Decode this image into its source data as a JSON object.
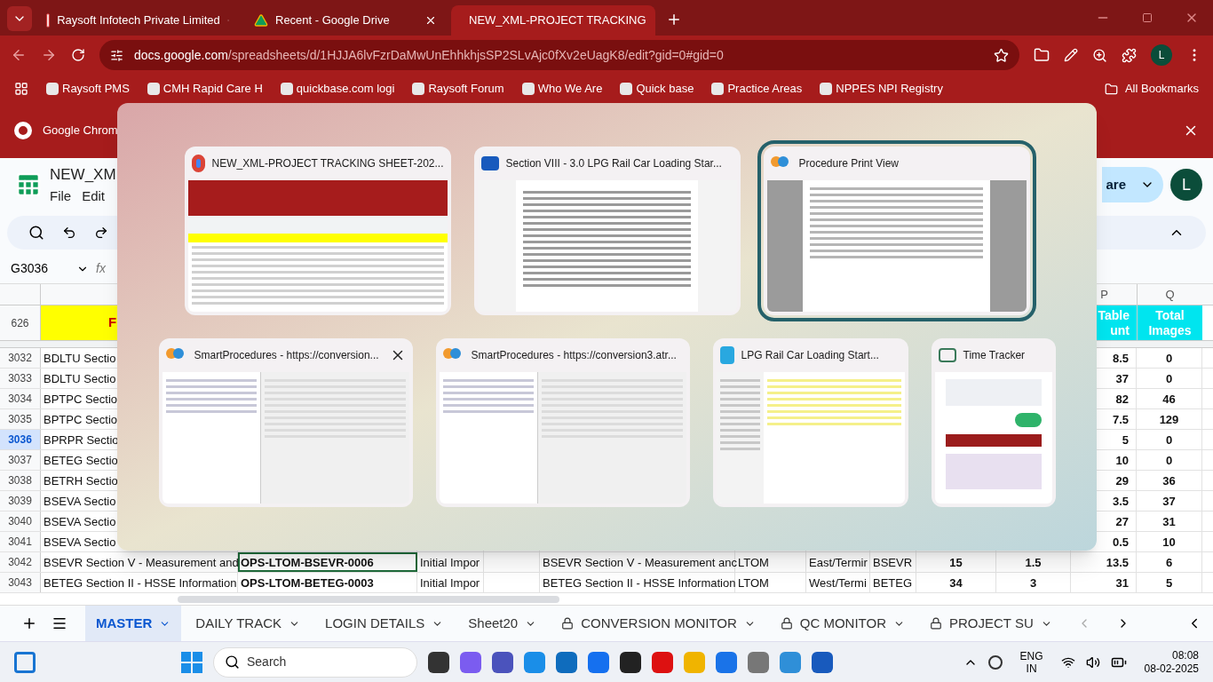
{
  "browser": {
    "tabs": [
      {
        "title": "Raysoft Infotech Private Limited",
        "kind": "company",
        "selected": false
      },
      {
        "title": "Recent - Google Drive",
        "kind": "drive",
        "selected": false
      },
      {
        "title": "NEW_XML-PROJECT TRACKING",
        "kind": "sheets",
        "selected": true
      }
    ],
    "url_host": "docs.google.com",
    "url_path": "/spreadsheets/d/1HJJA6lvFzrDaMwUnEhhkhjsSP2SLvAjc0fXv2eUagK8/edit?gid=0#gid=0",
    "profile": "L",
    "bookmarks": [
      "Raysoft PMS",
      "CMH Rapid Care H",
      "quickbase.com logi",
      "Raysoft Forum",
      "Who We Are",
      "Quick base",
      "Practice Areas",
      "NPPES NPI Registry"
    ],
    "all_bookmarks": "All Bookmarks"
  },
  "infobar": {
    "text": "Google Chrom"
  },
  "sheet": {
    "title": "NEW_XM",
    "menu": [
      "File",
      "Edit"
    ],
    "share": "are",
    "avatar": "L",
    "name_box": "G3036",
    "formula_label": "fx"
  },
  "grid": {
    "column_letters": {
      "p": "P",
      "q": "Q"
    },
    "header_row": {
      "number": "626",
      "column_1": "F",
      "p": [
        "Table",
        "unt"
      ],
      "q": [
        "Total",
        "Images"
      ]
    },
    "rows": [
      {
        "number": "3032",
        "selected": false,
        "cells": {
          "column_1": "BDLTU Sectio",
          "column_11": "8.5",
          "column_12": "0"
        }
      },
      {
        "number": "3033",
        "selected": false,
        "cells": {
          "column_1": "BDLTU Sectio",
          "column_11": "37",
          "column_12": "0"
        }
      },
      {
        "number": "3034",
        "selected": false,
        "cells": {
          "column_1": "BPTPC Sectio",
          "column_11": "82",
          "column_12": "46"
        }
      },
      {
        "number": "3035",
        "selected": false,
        "cells": {
          "column_1": "BPTPC Sectio",
          "column_11": "7.5",
          "column_12": "129"
        }
      },
      {
        "number": "3036",
        "selected": true,
        "cells": {
          "column_1": "BPRPR Sectio",
          "column_11": "5",
          "column_12": "0"
        }
      },
      {
        "number": "3037",
        "selected": false,
        "cells": {
          "column_1": "BETEG Sectio",
          "column_11": "10",
          "column_12": "0"
        }
      },
      {
        "number": "3038",
        "selected": false,
        "cells": {
          "column_1": "BETRH Sectio",
          "column_11": "29",
          "column_12": "36"
        }
      },
      {
        "number": "3039",
        "selected": false,
        "cells": {
          "column_1": "BSEVA Sectio",
          "column_11": "3.5",
          "column_12": "37"
        }
      },
      {
        "number": "3040",
        "selected": false,
        "cells": {
          "column_1": "BSEVA Sectio",
          "column_11": "27",
          "column_12": "31"
        }
      },
      {
        "number": "3041",
        "selected": false,
        "cells": {
          "column_1": "BSEVA Sectio",
          "column_11": "0.5",
          "column_12": "10"
        }
      },
      {
        "number": "3042",
        "selected": false,
        "cells": {
          "column_1": "BSEVR Section V - Measurement and",
          "column_2": "OPS-LTOM-BSEVR-0006",
          "column_3": "Initial Impor",
          "column_5": "BSEVR Section V - Measurement anc",
          "column_6": "LTOM",
          "column_7": "East/Termir",
          "column_8": "BSEVR",
          "column_9": "15",
          "column_10": "1.5",
          "column_11": "13.5",
          "column_12": "6"
        }
      },
      {
        "number": "3043",
        "selected": false,
        "cells": {
          "column_1": "BETEG Section II - HSSE Information",
          "column_2": "OPS-LTOM-BETEG-0003",
          "column_3": "Initial Impor",
          "column_5": "BETEG Section II - HSSE Information",
          "column_6": "LTOM",
          "column_7": "West/Termi",
          "column_8": "BETEG",
          "column_9": "34",
          "column_10": "3",
          "column_11": "31",
          "column_12": "5"
        }
      }
    ]
  },
  "sheet_tabs": [
    {
      "label": "MASTER",
      "locked": false,
      "selected": true
    },
    {
      "label": "DAILY TRACK",
      "locked": false,
      "selected": false
    },
    {
      "label": "LOGIN DETAILS",
      "locked": false,
      "selected": false
    },
    {
      "label": "Sheet20",
      "locked": false,
      "selected": false
    },
    {
      "label": "CONVERSION MONITOR",
      "locked": true,
      "selected": false
    },
    {
      "label": "QC MONITOR",
      "locked": true,
      "selected": false
    },
    {
      "label": "PROJECT SU",
      "locked": true,
      "selected": false
    }
  ],
  "switcher": {
    "top_row": [
      {
        "title": "NEW_XML-PROJECT TRACKING SHEET-202...",
        "kind": "spreadsheet",
        "selected": false,
        "close_button": false
      },
      {
        "title": "Section VIII - 3.0 LPG Rail Car Loading Star...",
        "kind": "document",
        "selected": false,
        "close_button": false
      },
      {
        "title": "Procedure Print View",
        "kind": "print",
        "selected": true,
        "close_button": false
      }
    ],
    "bottom_row": [
      {
        "title": "SmartProcedures - https://conversion...",
        "kind": "app",
        "selected": false,
        "close_button": true
      },
      {
        "title": "SmartProcedures - https://conversion3.atr...",
        "kind": "app",
        "selected": false,
        "close_button": false
      },
      {
        "title": "LPG Rail Car Loading Start...",
        "kind": "explorer",
        "selected": false,
        "close_button": false
      },
      {
        "title": "Time Tracker",
        "kind": "tracker",
        "selected": false,
        "close_button": false
      }
    ]
  },
  "taskbar": {
    "search": "Search",
    "language": [
      "ENG",
      "IN"
    ],
    "time": "08:08",
    "date": "08-02-2025"
  }
}
